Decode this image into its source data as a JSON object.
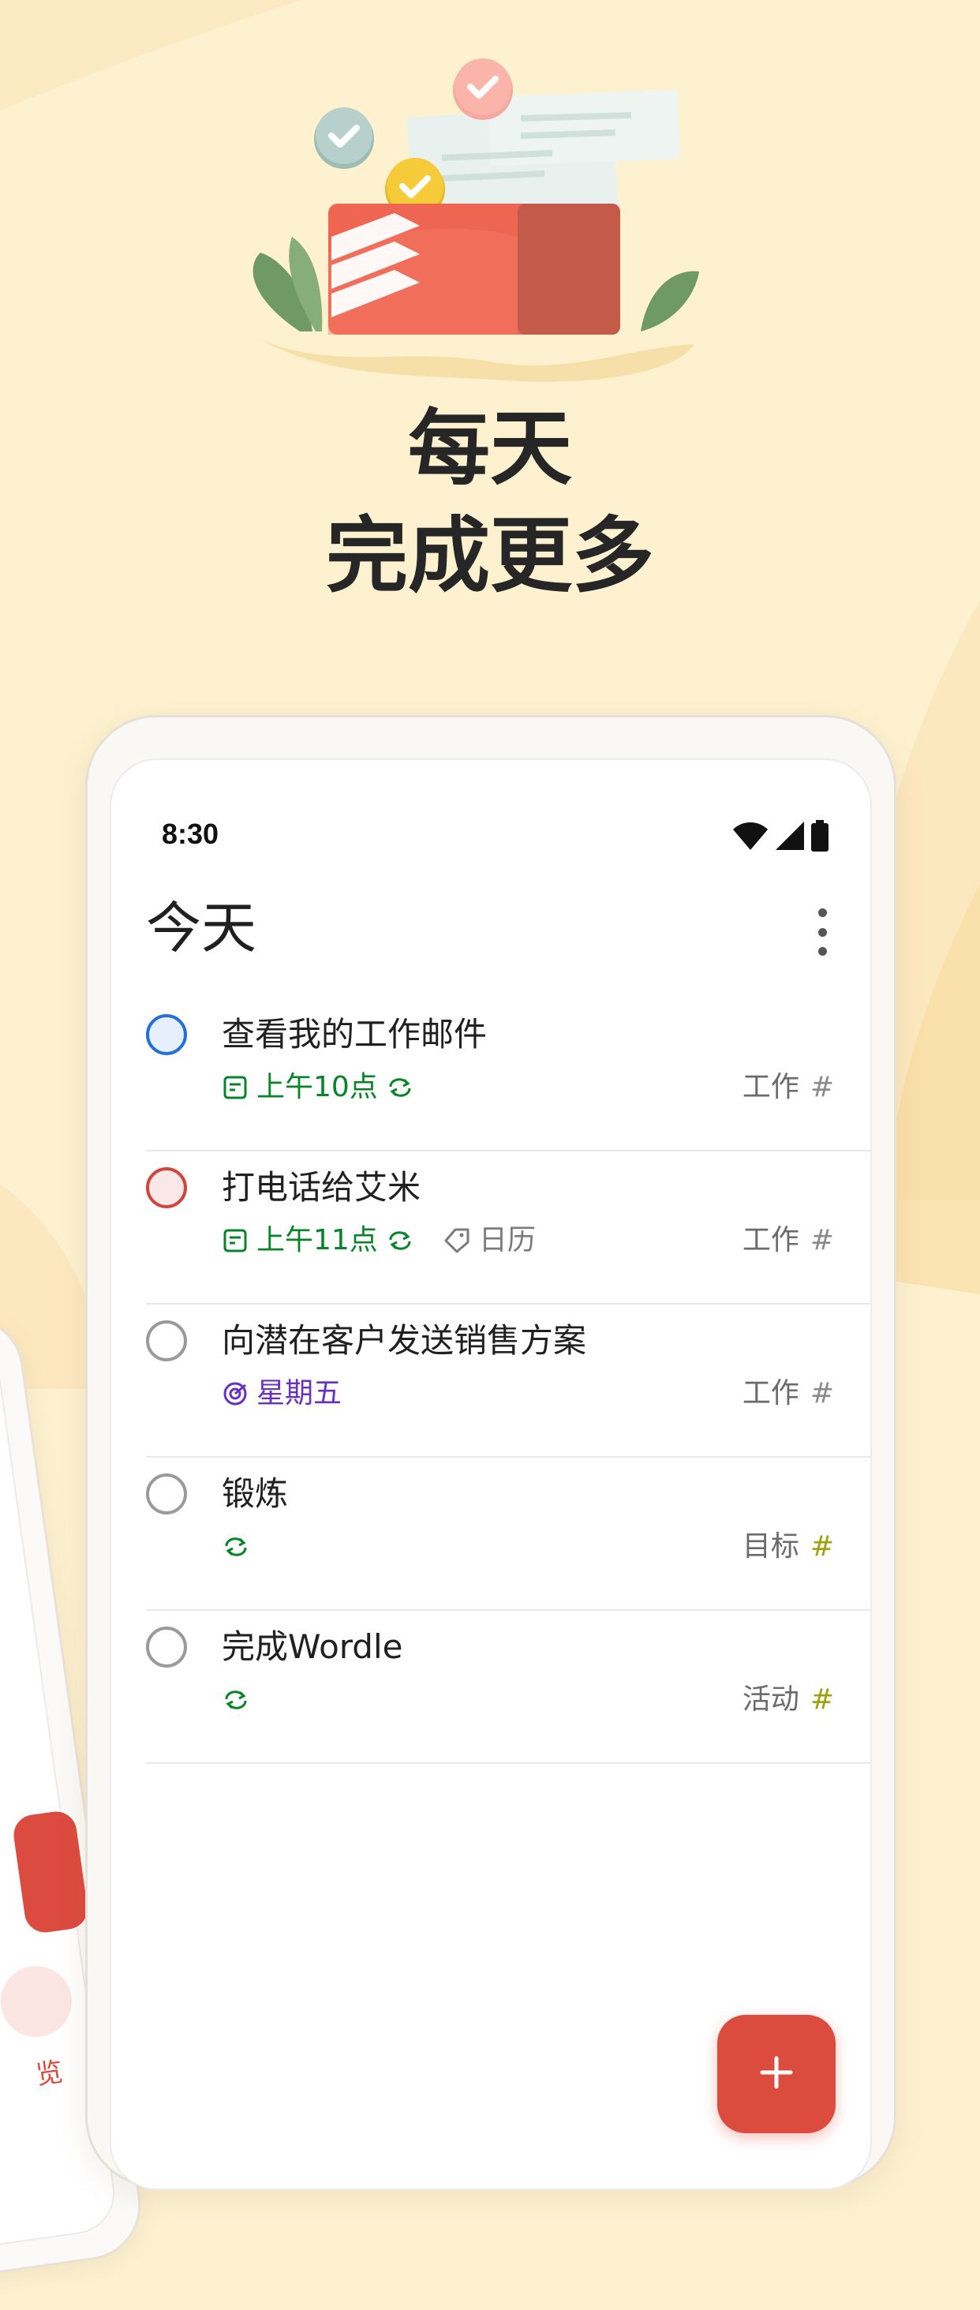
{
  "headline": {
    "line1": "每天",
    "line2": "完成更多"
  },
  "status_bar": {
    "time": "8:30",
    "icons": [
      "wifi-icon",
      "cellular-signal-icon",
      "battery-icon"
    ]
  },
  "screen": {
    "title": "今天",
    "menu_icon": "more-vertical-icon"
  },
  "tasks": [
    {
      "name": "查看我的工作邮件",
      "priority_color": "#246fe0",
      "due": "上午10点",
      "recurring": true,
      "label": "",
      "project": "工作",
      "project_color": "#8a8a8a"
    },
    {
      "name": "打电话给艾米",
      "priority_color": "#d1453b",
      "due": "上午11点",
      "recurring": true,
      "label": "日历",
      "project": "工作",
      "project_color": "#8a8a8a"
    },
    {
      "name": "向潜在客户发送销售方案",
      "priority_color": "#9a9a9a",
      "due": "星期五",
      "recurring": false,
      "label": "",
      "project": "工作",
      "project_color": "#8a8a8a"
    },
    {
      "name": "锻炼",
      "priority_color": "#9a9a9a",
      "due": "",
      "recurring": true,
      "label": "",
      "project": "目标",
      "project_color": "#9ea10d"
    },
    {
      "name": "完成Wordle",
      "priority_color": "#9a9a9a",
      "due": "",
      "recurring": true,
      "label": "",
      "project": "活动",
      "project_color": "#9ea10d"
    }
  ],
  "project_hash": "#",
  "fab": {
    "icon": "plus-icon",
    "color": "#dc4c3e"
  },
  "back_phone": {
    "partial_text": "览"
  },
  "colors": {
    "background": "#fdf1cf",
    "accent": "#dc4c3e",
    "date_green": "#058527",
    "date_purple": "#692ec2"
  }
}
